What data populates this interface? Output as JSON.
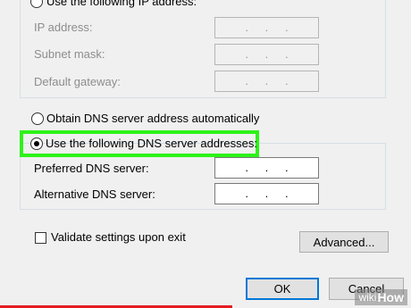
{
  "ip_section": {
    "use_following_label": "Use the following IP address:",
    "fields": [
      {
        "label": "IP address:",
        "octets": [
          ".",
          ".",
          "."
        ]
      },
      {
        "label": "Subnet mask:",
        "octets": [
          ".",
          ".",
          "."
        ]
      },
      {
        "label": "Default gateway:",
        "octets": [
          ".",
          ".",
          "."
        ]
      }
    ]
  },
  "dns_section": {
    "auto_label": "Obtain DNS server address automatically",
    "use_following_label": "Use the following DNS server addresses:",
    "fields": [
      {
        "label": "Preferred DNS server:",
        "octets": [
          ".",
          ".",
          "."
        ]
      },
      {
        "label": "Alternative DNS server:",
        "octets": [
          ".",
          ".",
          "."
        ]
      }
    ]
  },
  "validate": {
    "label": "Validate settings upon exit"
  },
  "buttons": {
    "advanced": "Advanced...",
    "ok": "OK",
    "cancel": "Cancel"
  },
  "watermark": {
    "wiki": "wiki",
    "how": "How"
  },
  "colors": {
    "highlight": "#2ef21a",
    "default_button_border": "#0078d7"
  }
}
